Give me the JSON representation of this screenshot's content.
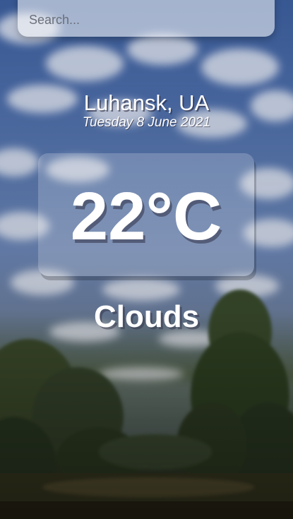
{
  "search": {
    "placeholder": "Search...",
    "value": ""
  },
  "weather": {
    "location": "Luhansk, UA",
    "date": "Tuesday 8 June 2021",
    "temperature": "22°C",
    "condition": "Clouds"
  },
  "colors": {
    "sky_top": "#3a5c9a",
    "ground": "#252b1c",
    "text": "#ffffff"
  }
}
